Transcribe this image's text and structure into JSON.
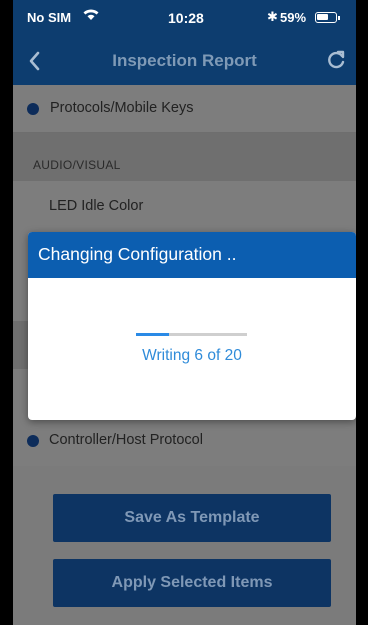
{
  "status_bar": {
    "carrier": "No SIM",
    "time": "10:28",
    "bluetooth": "✱",
    "battery_percent": "59%",
    "battery_level": 0.59,
    "icons": [
      "wifi-icon",
      "bluetooth-icon",
      "battery-icon"
    ]
  },
  "nav": {
    "title": "Inspection Report",
    "back_icon": "chevron-left-icon",
    "refresh_icon": "refresh-icon"
  },
  "list": {
    "protocols_label": "Protocols/Mobile Keys",
    "section_audio_visual": "AUDIO/VISUAL",
    "led_label": "LED Idle Color",
    "controller_label": "Controller/Host Protocol"
  },
  "buttons": {
    "save_template": "Save As Template",
    "apply_selected": "Apply Selected Items"
  },
  "modal": {
    "title": "Changing Configuration ..",
    "progress_text": "Writing 6 of 20",
    "progress_fraction": 0.3
  },
  "colors": {
    "nav_bar": "#0d3d6f",
    "modal_header": "#0c5eb0",
    "progress_accent": "#2a8ae6",
    "button_bg": "#0d3463"
  }
}
